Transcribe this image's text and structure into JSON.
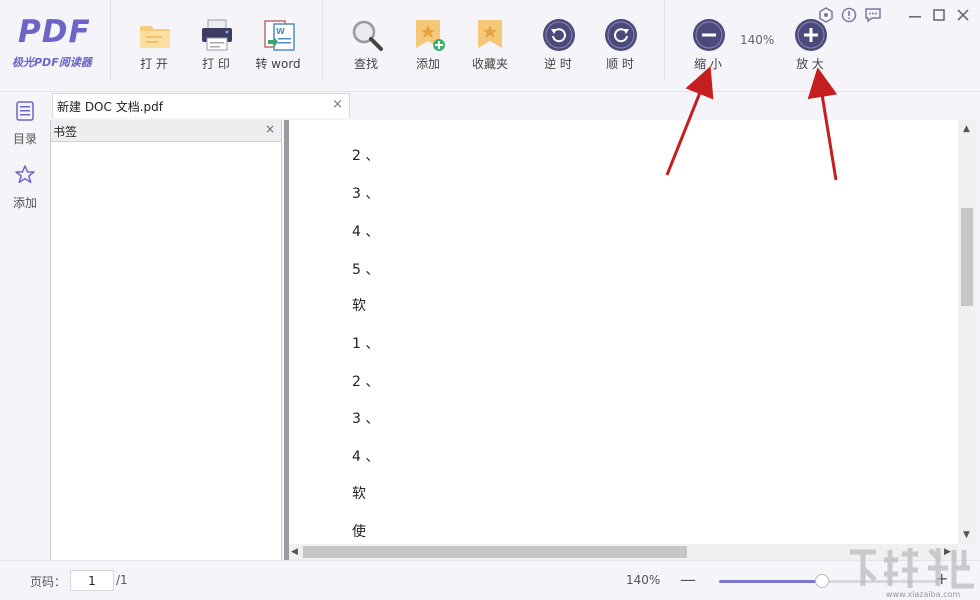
{
  "app": {
    "logo_mark": "PDF",
    "logo_text": "极光PDF阅读器"
  },
  "toolbar": {
    "buttons": [
      {
        "id": "open",
        "label": "打 开",
        "icon": "folder-icon"
      },
      {
        "id": "print",
        "label": "打 印",
        "icon": "printer-icon"
      },
      {
        "id": "to-word",
        "label": "转 word",
        "icon": "word-convert-icon"
      },
      {
        "id": "find",
        "label": "查找",
        "icon": "search-icon"
      },
      {
        "id": "add",
        "label": "添加",
        "icon": "bookmark-add-icon"
      },
      {
        "id": "favorites",
        "label": "收藏夹",
        "icon": "bookmark-star-icon"
      },
      {
        "id": "rotate-ccw",
        "label": "逆 时",
        "icon": "rotate-left-icon"
      },
      {
        "id": "rotate-cw",
        "label": "顺 时",
        "icon": "rotate-right-icon"
      },
      {
        "id": "zoom-out",
        "label": "缩 小",
        "icon": "minus-circle-icon"
      },
      {
        "id": "zoom-in",
        "label": "放 大",
        "icon": "plus-circle-icon"
      }
    ],
    "zoom_value": "140%"
  },
  "window_controls": [
    "settings-hex-icon",
    "info-icon",
    "feedback-icon",
    "minimize-icon",
    "maximize-icon",
    "close-icon"
  ],
  "rail": {
    "items": [
      {
        "label": "目录",
        "icon": "list-icon"
      },
      {
        "label": "添加",
        "icon": "star-icon"
      }
    ]
  },
  "tab": {
    "title": "新建 DOC 文档.pdf",
    "close": "×"
  },
  "bookmark_panel": {
    "title": "书签",
    "close": "×"
  },
  "document": {
    "lines": [
      "2 、",
      "3 、",
      "4 、",
      "5 、",
      "软",
      "1 、",
      "2 、",
      "3 、",
      "4 、",
      "软",
      "使"
    ]
  },
  "statusbar": {
    "page_label": "页码：",
    "page_value": "1",
    "page_total": "/1",
    "zoom": "140%",
    "minus": "—",
    "plus": "+",
    "zoom_slider_fraction": 0.47
  },
  "watermark": {
    "text": "www.xiazaiba.com"
  },
  "colors": {
    "accent": "#6b66c6",
    "icon_dark": "#4b4a7a",
    "bookmark_orange": "#f5c878",
    "arrow_red": "#c41e1e"
  }
}
